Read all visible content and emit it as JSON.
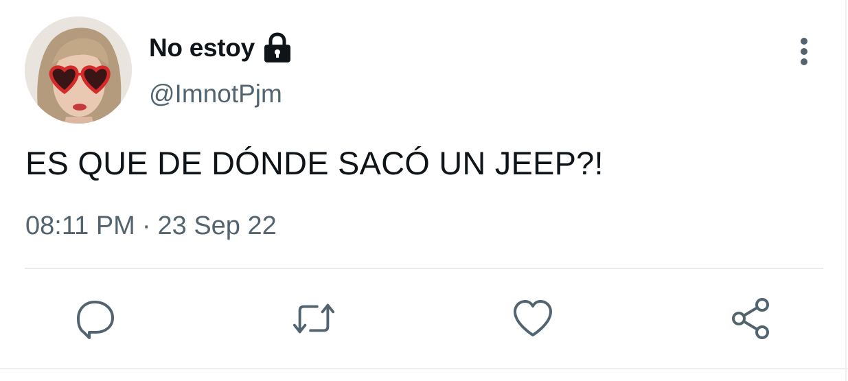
{
  "tweet": {
    "display_name": "No estoy",
    "handle": "@ImnotPjm",
    "text": "ES QUE DE DÓNDE SACÓ UN JEEP?!",
    "time": "08:11 PM",
    "separator": "·",
    "date": "23 Sep 22",
    "protected": true
  },
  "icons": {
    "lock": "lock-icon",
    "more": "more-vertical-icon",
    "reply": "reply-icon",
    "retweet": "retweet-icon",
    "like": "heart-icon",
    "share": "share-icon"
  },
  "colors": {
    "text": "#0f1419",
    "secondary": "#536471",
    "divider": "#e6ecf0",
    "background": "#ffffff"
  }
}
